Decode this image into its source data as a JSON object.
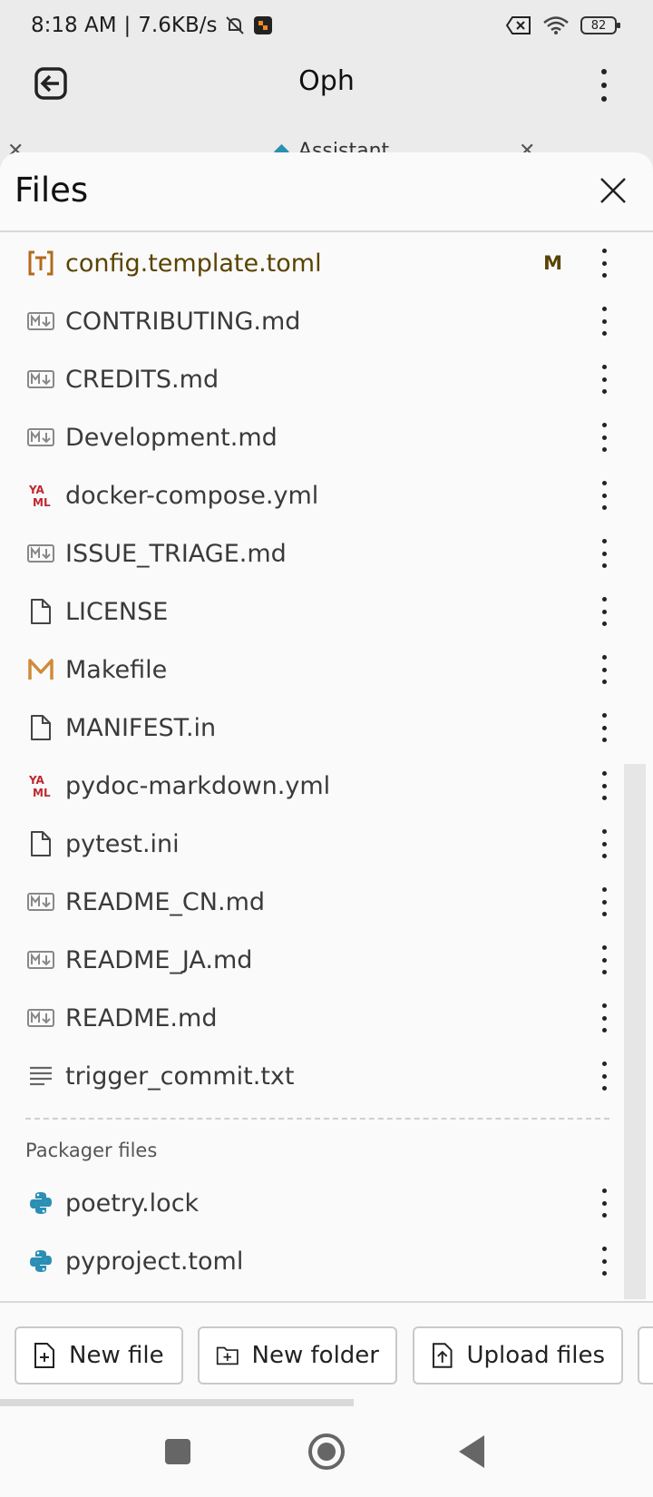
{
  "status_bar": {
    "time": "8:18 AM",
    "separator": "|",
    "speed": "7.6KB/s",
    "battery": "82"
  },
  "header": {
    "title": "Oph"
  },
  "tabs_peek": {
    "assistant_label": "Assistant"
  },
  "sheet": {
    "title": "Files"
  },
  "files": [
    {
      "name": "config.template.toml",
      "icon": "toml-icon",
      "badge": "M"
    },
    {
      "name": "CONTRIBUTING.md",
      "icon": "markdown-icon"
    },
    {
      "name": "CREDITS.md",
      "icon": "markdown-icon"
    },
    {
      "name": "Development.md",
      "icon": "markdown-icon"
    },
    {
      "name": "docker-compose.yml",
      "icon": "yaml-icon"
    },
    {
      "name": "ISSUE_TRIAGE.md",
      "icon": "markdown-icon"
    },
    {
      "name": "LICENSE",
      "icon": "file-icon"
    },
    {
      "name": "Makefile",
      "icon": "makefile-icon"
    },
    {
      "name": "MANIFEST.in",
      "icon": "file-icon"
    },
    {
      "name": "pydoc-markdown.yml",
      "icon": "yaml-icon"
    },
    {
      "name": "pytest.ini",
      "icon": "file-icon"
    },
    {
      "name": "README_CN.md",
      "icon": "markdown-icon"
    },
    {
      "name": "README_JA.md",
      "icon": "markdown-icon"
    },
    {
      "name": "README.md",
      "icon": "markdown-icon"
    },
    {
      "name": "trigger_commit.txt",
      "icon": "text-icon"
    }
  ],
  "packager": {
    "label": "Packager files",
    "files": [
      {
        "name": "poetry.lock",
        "icon": "python-icon"
      },
      {
        "name": "pyproject.toml",
        "icon": "python-icon"
      }
    ]
  },
  "toolbar": {
    "new_file": "New file",
    "new_folder": "New folder",
    "upload_files": "Upload files"
  },
  "colors": {
    "modified": "#5a4300",
    "yaml": "#c0282e",
    "makefile": "#d08a38",
    "python": "#2b8fb3",
    "toml": "#b46a1a"
  }
}
